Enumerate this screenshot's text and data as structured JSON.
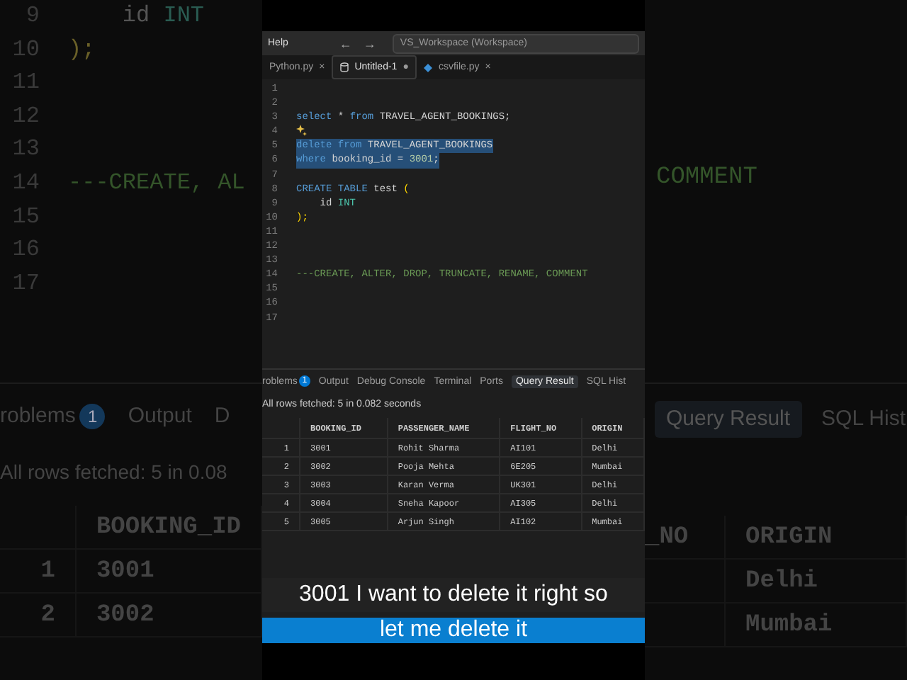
{
  "background": {
    "left": {
      "code_lines": [
        {
          "number": "9",
          "tokens": [
            {
              "kind": "plain",
              "text": "    id "
            },
            {
              "kind": "type",
              "text": "INT"
            }
          ]
        },
        {
          "number": "10",
          "tokens": [
            {
              "kind": "bracket",
              "text": ");"
            }
          ]
        },
        {
          "number": "11"
        },
        {
          "number": "12"
        },
        {
          "number": "13"
        },
        {
          "number": "14",
          "tokens": [
            {
              "kind": "comment",
              "text": "---CREATE, AL"
            }
          ]
        },
        {
          "number": "15"
        },
        {
          "number": "16"
        },
        {
          "number": "17"
        }
      ],
      "panel_tabs": [
        {
          "label": "roblems",
          "badge": "1",
          "selected": false
        },
        {
          "label": "Output",
          "selected": false
        },
        {
          "label": "D",
          "selected": false
        }
      ],
      "status": "All rows fetched: 5 in 0.08",
      "columns": [
        "",
        "BOOKING_ID"
      ],
      "rows": [
        [
          "1",
          "3001"
        ],
        [
          "2",
          "3002"
        ]
      ]
    },
    "right": {
      "comment": "COMMENT",
      "panel_tabs": [
        {
          "label": "Query Result",
          "selected": true
        },
        {
          "label": "SQL Hist",
          "selected": false
        }
      ],
      "columns": [
        "_NO",
        "ORIGIN"
      ],
      "rows": [
        [
          "",
          "Delhi"
        ],
        [
          "",
          "Mumbai"
        ]
      ]
    }
  },
  "window": {
    "menu": "Help",
    "back": "←",
    "forward": "→",
    "search": {
      "value": "VS_Workspace (Workspace)"
    }
  },
  "tabs": [
    {
      "label": "Python.py",
      "close": "×",
      "selected": false
    },
    {
      "label": "Untitled-1",
      "kind": "sql",
      "close": "●",
      "selected": true
    },
    {
      "label": "csvfile.py",
      "kind": "python",
      "close": "×",
      "selected": false
    }
  ],
  "editor": {
    "lines": [
      {
        "number": "1",
        "kind": "code",
        "selected": false
      },
      {
        "number": "2",
        "kind": "code",
        "selected": false
      },
      {
        "number": "3",
        "kind": "code",
        "selected": false,
        "tokens": [
          {
            "kind": "keyword",
            "text": "select"
          },
          {
            "kind": "plain",
            "text": " * "
          },
          {
            "kind": "keyword",
            "text": "from"
          },
          {
            "kind": "plain",
            "text": " TRAVEL_AGENT_BOOKINGS;"
          }
        ]
      },
      {
        "number": "4",
        "kind": "hint",
        "selected": false
      },
      {
        "number": "5",
        "kind": "code",
        "selected": true,
        "tokens": [
          {
            "kind": "keyword",
            "text": "delete from"
          },
          {
            "kind": "plain",
            "text": " TRAVEL_AGENT_BOOKINGS"
          }
        ]
      },
      {
        "number": "6",
        "kind": "code",
        "selected": true,
        "tokens": [
          {
            "kind": "keyword",
            "text": "where"
          },
          {
            "kind": "plain",
            "text": " booking_id = "
          },
          {
            "kind": "number",
            "text": "3001"
          },
          {
            "kind": "plain",
            "text": ";"
          }
        ]
      },
      {
        "number": "7",
        "kind": "code",
        "selected": false
      },
      {
        "number": "8",
        "kind": "code",
        "selected": false,
        "tokens": [
          {
            "kind": "keyword",
            "text": "CREATE TABLE"
          },
          {
            "kind": "plain",
            "text": " test "
          },
          {
            "kind": "bracket",
            "text": "("
          }
        ]
      },
      {
        "number": "9",
        "kind": "code",
        "selected": false,
        "tokens": [
          {
            "kind": "plain",
            "text": "    id "
          },
          {
            "kind": "type",
            "text": "INT"
          }
        ]
      },
      {
        "number": "10",
        "kind": "code",
        "selected": false,
        "tokens": [
          {
            "kind": "bracket",
            "text": ");"
          }
        ]
      },
      {
        "number": "11",
        "kind": "code",
        "selected": false
      },
      {
        "number": "12",
        "kind": "code",
        "selected": false
      },
      {
        "number": "13",
        "kind": "code",
        "selected": false
      },
      {
        "number": "14",
        "kind": "code",
        "selected": false,
        "tokens": [
          {
            "kind": "comment",
            "text": "---CREATE, ALTER, DROP, TRUNCATE, RENAME, COMMENT"
          }
        ]
      },
      {
        "number": "15",
        "kind": "code",
        "selected": false
      },
      {
        "number": "16",
        "kind": "code",
        "selected": false
      },
      {
        "number": "17",
        "kind": "code",
        "selected": false
      }
    ]
  },
  "panel": {
    "tabs": [
      {
        "label": "roblems",
        "badge": "1",
        "selected": false
      },
      {
        "label": "Output",
        "selected": false
      },
      {
        "label": "Debug Console",
        "selected": false
      },
      {
        "label": "Terminal",
        "selected": false
      },
      {
        "label": "Ports",
        "selected": false
      },
      {
        "label": "Query Result",
        "selected": true
      },
      {
        "label": "SQL Hist",
        "selected": false
      }
    ],
    "status": "All rows fetched: 5 in 0.082 seconds",
    "table": {
      "columns": [
        "",
        "BOOKING_ID",
        "PASSENGER_NAME",
        "FLIGHT_NO",
        "ORIGIN"
      ],
      "rows": [
        [
          "1",
          "3001",
          "Rohit Sharma",
          "AI101",
          "Delhi"
        ],
        [
          "2",
          "3002",
          "Pooja Mehta",
          "6E205",
          "Mumbai"
        ],
        [
          "3",
          "3003",
          "Karan Verma",
          "UK301",
          "Delhi"
        ],
        [
          "4",
          "3004",
          "Sneha Kapoor",
          "AI305",
          "Delhi"
        ],
        [
          "5",
          "3005",
          "Arjun Singh",
          "AI102",
          "Mumbai"
        ]
      ]
    }
  },
  "captions": [
    {
      "text": "3001 I want to delete it right so",
      "highlighted": false
    },
    {
      "text": "let me delete it",
      "highlighted": true
    }
  ]
}
